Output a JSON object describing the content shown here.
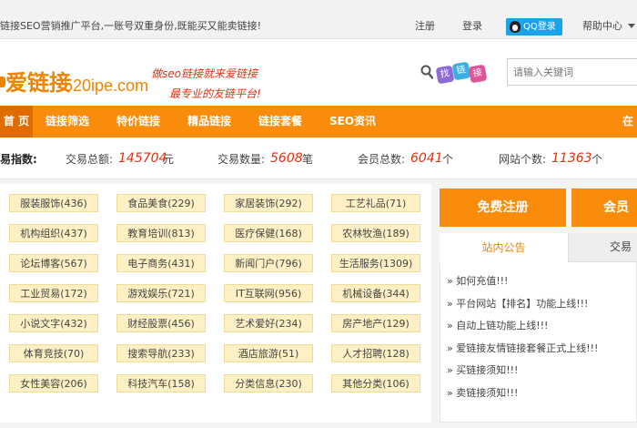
{
  "topbar": {
    "intro": "链接SEO营销推广平台,一账号双重身份,既能买又能卖链接!",
    "register": "注册",
    "login": "登录",
    "qq_login": "QQ登录",
    "help": "帮助中心"
  },
  "header": {
    "logo_text": "爱链接",
    "logo_domain": "520ipe.com",
    "slogan_line1": "做seo链接就来爱链接",
    "slogan_line2": "最专业的友链平台!",
    "search_bubbles": [
      "找",
      "链",
      "接"
    ],
    "search_placeholder": "请输入关键词",
    "colors": {
      "brand": "#f98c0b",
      "slogan": "#e03010"
    }
  },
  "nav": {
    "items": [
      "首 页",
      "链接筛选",
      "特价链接",
      "精品链接",
      "链接套餐",
      "SEO资讯",
      "在"
    ]
  },
  "stats": {
    "label": "易指数:",
    "total_amount_label": "交易总额:",
    "total_amount": "145704",
    "total_amount_unit": "元",
    "trade_count_label": "交易数量:",
    "trade_count": "5608",
    "trade_count_unit": "笔",
    "member_label": "会员总数:",
    "member_count": "6041",
    "member_unit": "个",
    "site_label": "网站个数:",
    "site_count": "11363",
    "site_unit": "个"
  },
  "categories": [
    [
      "服装服饰(436)",
      "食品美食(229)",
      "家居装饰(292)",
      "工艺礼品(71)"
    ],
    [
      "机构组织(437)",
      "教育培训(813)",
      "医疗保健(168)",
      "农林牧渔(189)"
    ],
    [
      "论坛博客(567)",
      "电子商务(431)",
      "新闻门户(796)",
      "生活服务(1309)"
    ],
    [
      "工业贸易(172)",
      "游戏娱乐(721)",
      "IT互联网(956)",
      "机械设备(344)"
    ],
    [
      "小说文字(432)",
      "财经股票(456)",
      "艺术爱好(234)",
      "房产地产(129)"
    ],
    [
      "体育竞技(70)",
      "搜索导航(233)",
      "酒店旅游(51)",
      "人才招聘(128)"
    ],
    [
      "女性美容(206)",
      "科技汽车(158)",
      "分类信息(230)",
      "其他分类(106)"
    ]
  ],
  "sidebar": {
    "register_button": "免费注册",
    "vip_button": "会员",
    "tab_notice": "站内公告",
    "tab_trade": "交易",
    "news": [
      "» 如何充值!!!",
      "» 平台网站【排名】功能上线!!!",
      "» 自动上链功能上线!!!",
      "» 爱链接友情链接套餐正式上线!!!",
      "» 买链接须知!!!",
      "» 卖链接须知!!!"
    ]
  }
}
